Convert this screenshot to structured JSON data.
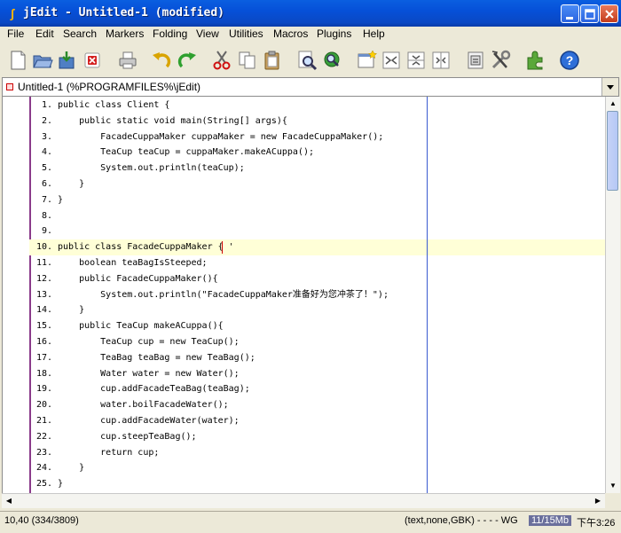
{
  "window": {
    "title": "jEdit - Untitled-1 (modified)",
    "app_icon": "jedit-icon",
    "controls": {
      "minimize": "minimize-icon",
      "maximize": "maximize-icon",
      "close": "close-icon"
    }
  },
  "menu": {
    "items": [
      "File",
      "Edit",
      "Search",
      "Markers",
      "Folding",
      "View",
      "Utilities",
      "Macros",
      "Plugins",
      "Help"
    ]
  },
  "toolbar": {
    "icons": [
      "new-file-icon",
      "open-folder-icon",
      "save-icon",
      "close-buffer-icon",
      "print-icon",
      "undo-icon",
      "redo-icon",
      "cut-icon",
      "copy-icon",
      "paste-icon",
      "find-icon",
      "find-in-files-icon",
      "new-view-icon",
      "split-horizontal-icon",
      "split-vertical-icon",
      "unsplit-icon",
      "buffer-options-icon",
      "global-options-icon",
      "plugin-manager-icon",
      "help-icon"
    ]
  },
  "buffer": {
    "label": "Untitled-1 (%PROGRAMFILES%\\jEdit)"
  },
  "editor": {
    "lines": [
      {
        "n": "1.",
        "code": "public class Client {"
      },
      {
        "n": "2.",
        "code": "    public static void main(String[] args){"
      },
      {
        "n": "3.",
        "code": "        FacadeCuppaMaker cuppaMaker = new FacadeCuppaMaker();"
      },
      {
        "n": "4.",
        "code": "        TeaCup teaCup = cuppaMaker.makeACuppa();"
      },
      {
        "n": "5.",
        "code": "        System.out.println(teaCup);"
      },
      {
        "n": "6.",
        "code": "    }"
      },
      {
        "n": "7.",
        "code": "}"
      },
      {
        "n": "8.",
        "code": ""
      },
      {
        "n": "9.",
        "code": ""
      },
      {
        "n": "10.",
        "code": "public class FacadeCuppaMaker { '"
      },
      {
        "n": "11.",
        "code": "    boolean teaBagIsSteeped;"
      },
      {
        "n": "12.",
        "code": "    public FacadeCuppaMaker(){"
      },
      {
        "n": "13.",
        "code": "        System.out.println(\"FacadeCuppaMaker准备好为您冲茶了！\");"
      },
      {
        "n": "14.",
        "code": "    }"
      },
      {
        "n": "15.",
        "code": "    public TeaCup makeACuppa(){"
      },
      {
        "n": "16.",
        "code": "        TeaCup cup = new TeaCup();"
      },
      {
        "n": "17.",
        "code": "        TeaBag teaBag = new TeaBag();"
      },
      {
        "n": "18.",
        "code": "        Water water = new Water();"
      },
      {
        "n": "19.",
        "code": "        cup.addFacadeTeaBag(teaBag);"
      },
      {
        "n": "20.",
        "code": "        water.boilFacadeWater();"
      },
      {
        "n": "21.",
        "code": "        cup.addFacadeWater(water);"
      },
      {
        "n": "22.",
        "code": "        cup.steepTeaBag();"
      },
      {
        "n": "23.",
        "code": "        return cup;"
      },
      {
        "n": "24.",
        "code": "    }"
      },
      {
        "n": "25.",
        "code": "}"
      }
    ]
  },
  "status": {
    "position": "10,40 (334/3809)",
    "mode": "(text,none,GBK) - - - - WG",
    "memory": "11/15Mb",
    "clock": "下午3:26"
  },
  "colors": {
    "gutter_border": "#8a3b8a",
    "wrap_guide": "#3a5ad0",
    "current_line": "#ffffd7",
    "caret": "#d00000",
    "titlebar": "#0a5fe0"
  }
}
